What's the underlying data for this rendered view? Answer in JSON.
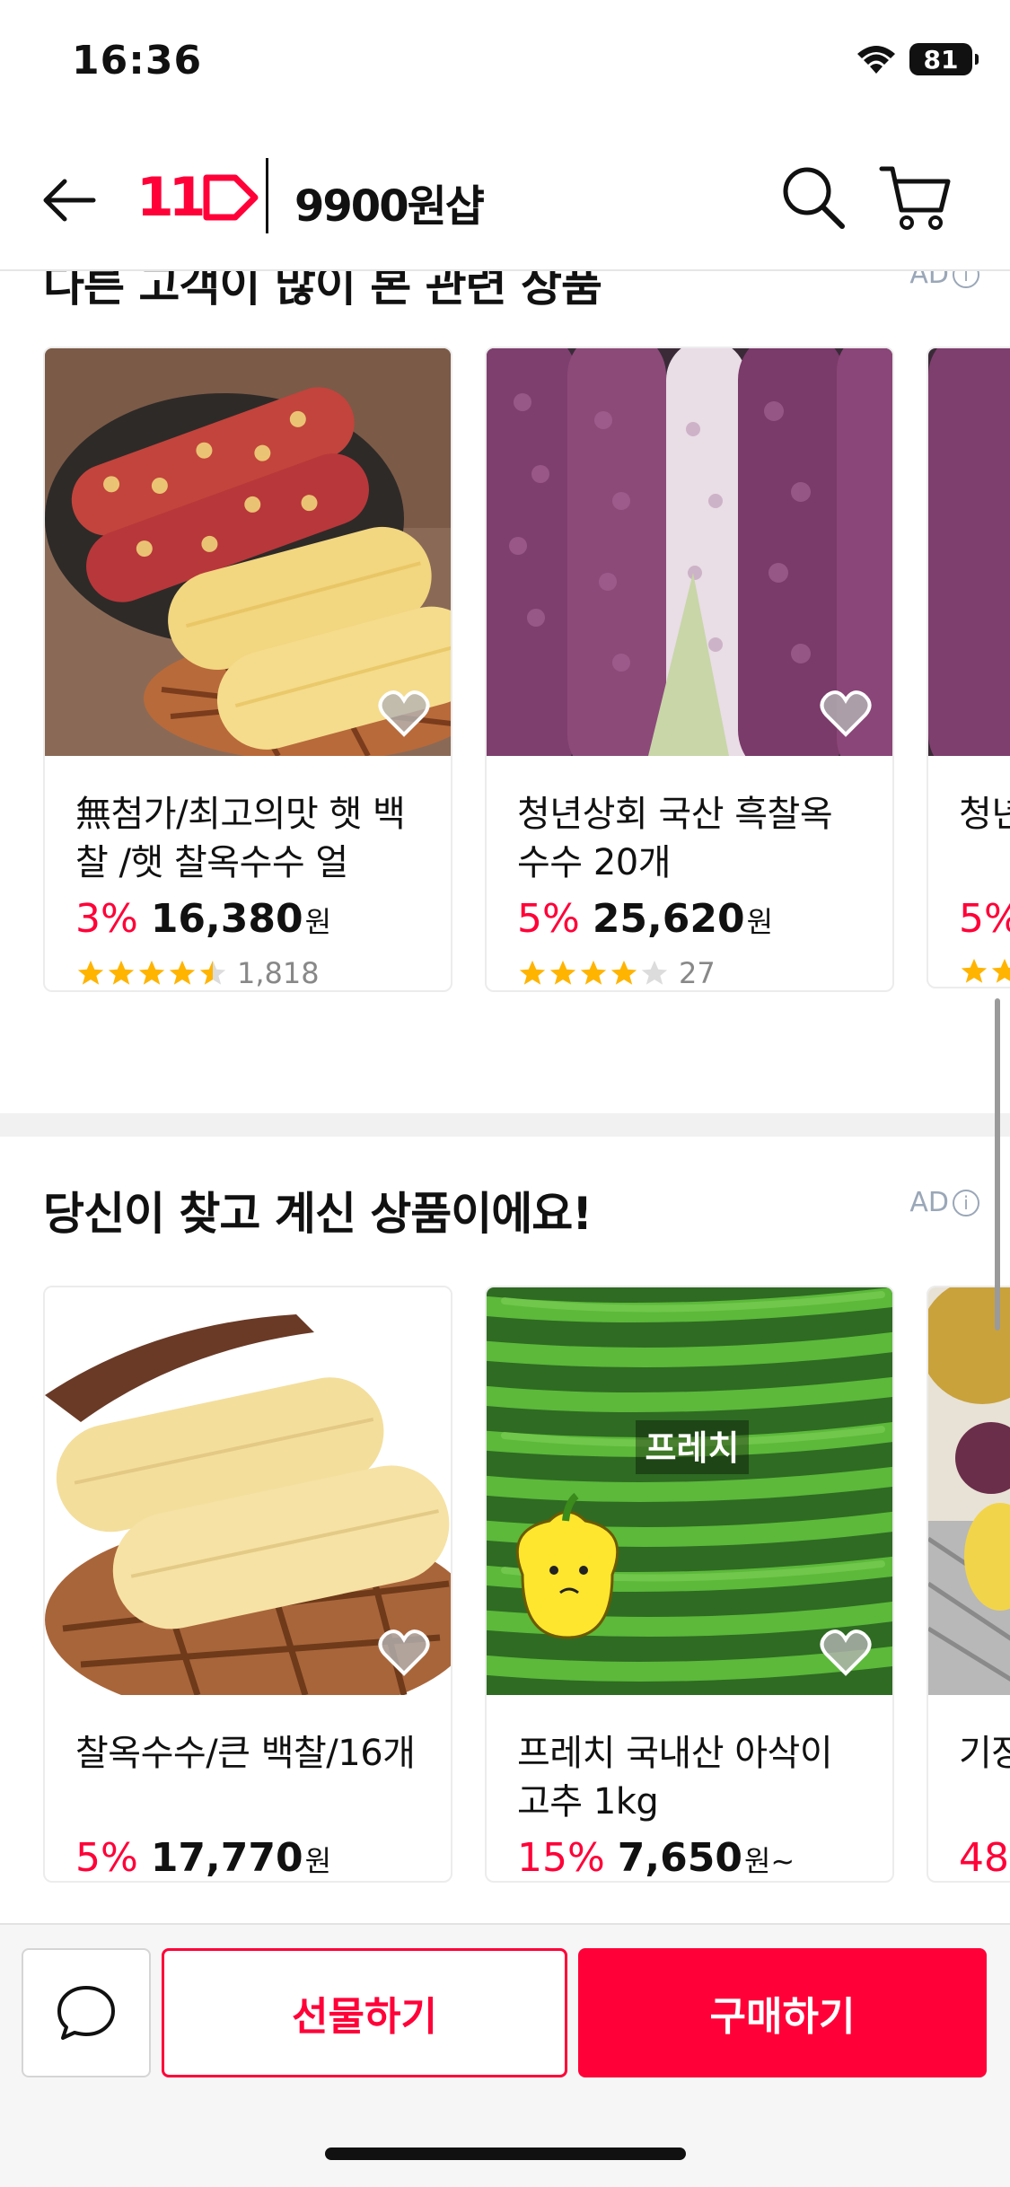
{
  "status_bar": {
    "time": "16:36",
    "battery": "81"
  },
  "header": {
    "logo": "11",
    "shop_name": "9900원샵"
  },
  "section1": {
    "title": "다른 고객이 많이 본 관련 상품",
    "ad_label": "AD",
    "cards": [
      {
        "name": "無첨가/최고의맛 햇 백찰 /햇 찰옥수수 얼",
        "discount": "3%",
        "price": "16,380",
        "currency": "원",
        "rating": 4.5,
        "review_count": "1,818"
      },
      {
        "name": "청년상회 국산 흑찰옥수수 20개",
        "discount": "5%",
        "price": "25,620",
        "currency": "원",
        "rating": 4,
        "review_count": "27"
      },
      {
        "name": "청년수수",
        "discount": "5%"
      }
    ]
  },
  "section2": {
    "title": "당신이 찾고 계신 상품이에요!",
    "ad_label": "AD",
    "cards": [
      {
        "name": "찰옥수수/큰 백찰/16개",
        "discount": "5%",
        "price": "17,770",
        "currency": "원"
      },
      {
        "name": "프레치 국내산 아삭이 고추 1kg",
        "discount": "15%",
        "price": "7,650",
        "currency": "원~",
        "image_text": "프레치"
      },
      {
        "name": "기장게 설",
        "discount": "48"
      }
    ]
  },
  "bottom_bar": {
    "gift_label": "선물하기",
    "buy_label": "구매하기"
  },
  "colors": {
    "accent": "#ff0038",
    "star": "#ffb400"
  }
}
